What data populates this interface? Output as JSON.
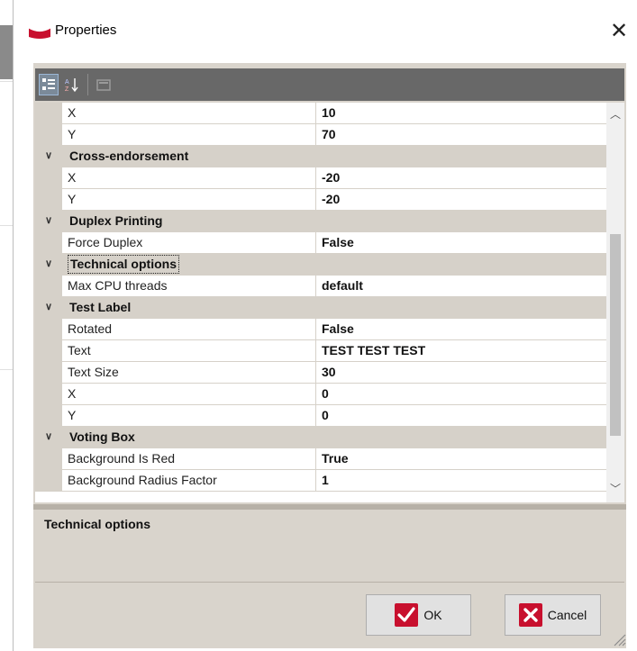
{
  "dialog": {
    "title": "Properties",
    "close_glyph": "✕",
    "logo_icon": "app-logo-icon",
    "accent_color": "#c8102e"
  },
  "toolbar": {
    "buttons": [
      {
        "name": "categorized-view-button",
        "icon": "categorized-icon",
        "active": true
      },
      {
        "name": "alphabetical-sort-button",
        "icon": "sort-az-icon",
        "active": false
      },
      {
        "name": "property-pages-button",
        "icon": "property-pages-icon",
        "active": false
      }
    ]
  },
  "grid": {
    "rows": [
      {
        "type": "prop",
        "name": "X",
        "value": "10"
      },
      {
        "type": "prop",
        "name": "Y",
        "value": "70"
      },
      {
        "type": "cat",
        "label": "Cross-endorsement",
        "expanded": true
      },
      {
        "type": "prop",
        "name": "X",
        "value": "-20"
      },
      {
        "type": "prop",
        "name": "Y",
        "value": "-20"
      },
      {
        "type": "cat",
        "label": "Duplex Printing",
        "expanded": true
      },
      {
        "type": "prop",
        "name": "Force Duplex",
        "value": "False"
      },
      {
        "type": "cat",
        "label": "Technical options",
        "expanded": true,
        "selected": true
      },
      {
        "type": "prop",
        "name": "Max CPU threads",
        "value": "default"
      },
      {
        "type": "cat",
        "label": "Test Label",
        "expanded": true
      },
      {
        "type": "prop",
        "name": "Rotated",
        "value": "False"
      },
      {
        "type": "prop",
        "name": "Text",
        "value": "TEST TEST TEST"
      },
      {
        "type": "prop",
        "name": "Text Size",
        "value": "30"
      },
      {
        "type": "prop",
        "name": "X",
        "value": "0"
      },
      {
        "type": "prop",
        "name": "Y",
        "value": "0"
      },
      {
        "type": "cat",
        "label": "Voting Box",
        "expanded": true
      },
      {
        "type": "prop",
        "name": "Background Is Red",
        "value": "True"
      },
      {
        "type": "prop",
        "name": "Background Radius Factor",
        "value": "1"
      }
    ]
  },
  "description": {
    "title": "Technical options"
  },
  "buttons": {
    "ok_label": "OK",
    "cancel_label": "Cancel"
  },
  "colors": {
    "panel": "#d9d4cc",
    "category_row": "#d6d1c9",
    "toolbar": "#686868"
  }
}
